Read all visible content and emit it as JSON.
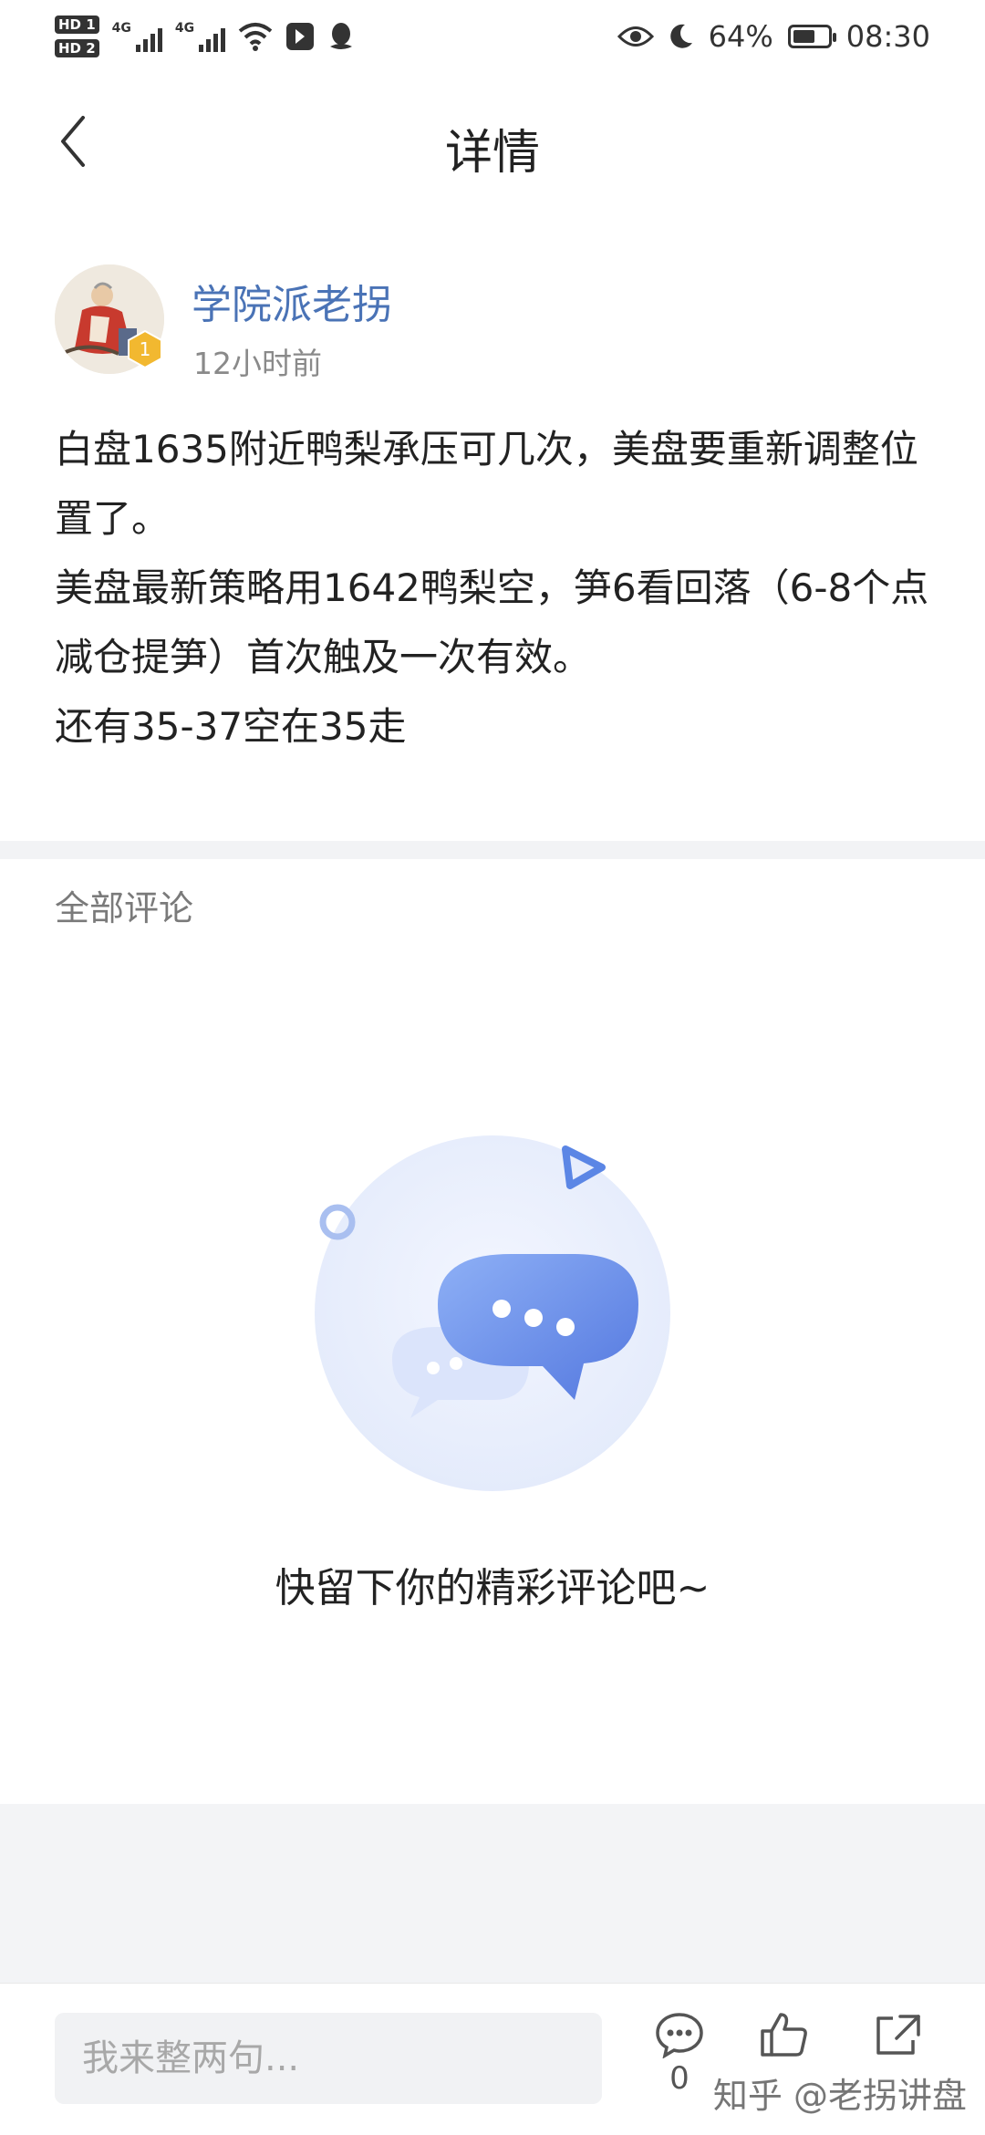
{
  "status_bar": {
    "sim1": "HD 1",
    "sim2": "HD 2",
    "network1": "4G",
    "network2": "4G",
    "battery_percent": "64%",
    "battery_level": 0.64,
    "time": "08:30"
  },
  "header": {
    "title": "详情"
  },
  "post": {
    "author": "学院派老拐",
    "badge_level": "1",
    "time": "12小时前",
    "lines": [
      "白盘1635附近鸭梨承压可几次，美盘要重新调整位置了。",
      "美盘最新策略用1642鸭梨空，笋6看回落（6-8个点减仓提笋）首次触及一次有效。",
      "还有35-37空在35走"
    ]
  },
  "comments": {
    "title": "全部评论",
    "empty_text": "快留下你的精彩评论吧~"
  },
  "bottom_bar": {
    "input_placeholder": "我来整两句...",
    "comment_count": "0",
    "watermark": "知乎 @老拐讲盘"
  },
  "colors": {
    "author": "#4a73b6",
    "accent": "#5b86e5",
    "divider": "#f2f3f5"
  },
  "icons": [
    "back-arrow-icon",
    "comment-icon",
    "like-icon",
    "share-icon",
    "eye-icon",
    "moon-icon",
    "wifi-icon",
    "battery-icon"
  ]
}
